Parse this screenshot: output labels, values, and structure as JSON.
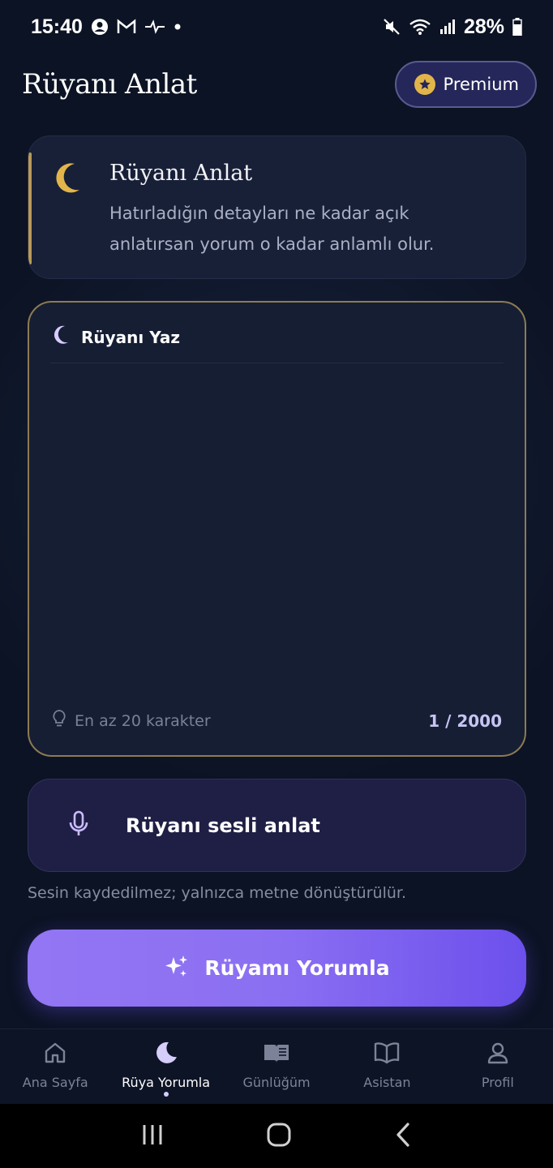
{
  "status_bar": {
    "time": "15:40",
    "battery": "28%"
  },
  "header": {
    "title": "Rüyanı Anlat",
    "premium_label": "Premium"
  },
  "intro_card": {
    "title": "Rüyanı Anlat",
    "description": "Hatırladığın detayları ne kadar açık anlatırsan yorum o kadar anlamlı olur."
  },
  "dream_input": {
    "heading": "Rüyanı Yaz",
    "value": "",
    "hint": "En az 20 karakter",
    "char_count": "1 / 2000"
  },
  "voice": {
    "label": "Rüyanı sesli anlat",
    "note": "Sesin kaydedilmez; yalnızca metne dönüştürülür."
  },
  "action": {
    "label": "Rüyamı Yorumla"
  },
  "bottom_nav": {
    "items": [
      {
        "label": "Ana Sayfa",
        "icon": "home-icon"
      },
      {
        "label": "Rüya Yorumla",
        "icon": "moon-icon",
        "active": true
      },
      {
        "label": "Günlüğüm",
        "icon": "journal-icon"
      },
      {
        "label": "Asistan",
        "icon": "book-open-icon"
      },
      {
        "label": "Profil",
        "icon": "user-icon"
      }
    ]
  },
  "colors": {
    "background": "#0c1324",
    "accent_gold": "#b89a58",
    "accent_purple": "#8b6ff2",
    "premium_bg": "#25265a"
  }
}
